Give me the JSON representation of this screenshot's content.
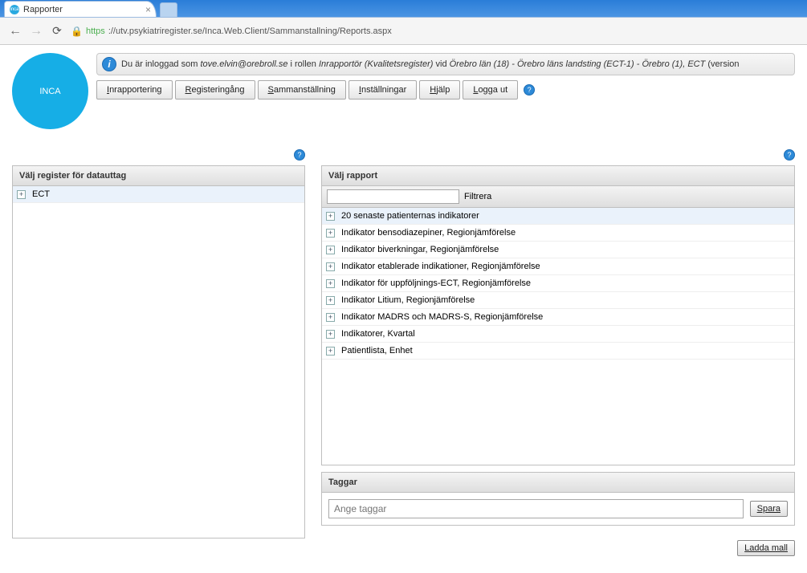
{
  "browser": {
    "tab_title": "Rapporter",
    "url_secure": "https",
    "url_rest": "://utv.psykiatriregister.se/Inca.Web.Client/Sammanstallning/Reports.aspx"
  },
  "logo": "INCA",
  "info": {
    "pre": "Du är inloggad som ",
    "user": "tove.elvin@orebroll.se",
    "mid": " i rollen ",
    "role": "Inrapportör (Kvalitetsregister)",
    "vid": " vid ",
    "org": "Örebro län (18) - Örebro läns landsting (ECT-1) - Örebro (1), ECT",
    "tail": " (version "
  },
  "menu": [
    "Inrapportering",
    "Registeringång",
    "Sammanställning",
    "Inställningar",
    "Hjälp",
    "Logga ut"
  ],
  "left": {
    "title": "Välj register för datauttag",
    "items": [
      "ECT"
    ]
  },
  "right": {
    "title": "Välj rapport",
    "filter_label": "Filtrera",
    "reports": [
      "20 senaste patienternas indikatorer",
      "Indikator bensodiazepiner, Regionjämförelse",
      "Indikator biverkningar, Regionjämförelse",
      "Indikator etablerade indikationer, Regionjämförelse",
      "Indikator för uppföljnings-ECT, Regionjämförelse",
      "Indikator Litium, Regionjämförelse",
      "Indikator MADRS och MADRS-S, Regionjämförelse",
      "Indikatorer, Kvartal",
      "Patientlista, Enhet"
    ]
  },
  "tags": {
    "title": "Taggar",
    "placeholder": "Ange taggar",
    "save": "Spara"
  },
  "load_template": "Ladda mall"
}
